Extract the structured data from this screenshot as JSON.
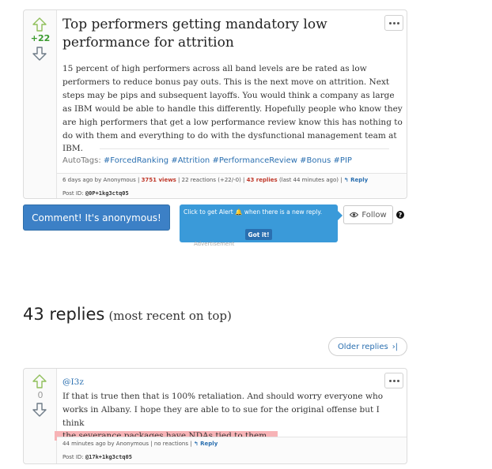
{
  "post": {
    "vote_score": "+22",
    "title": "Top performers getting mandatory low performance for attrition",
    "body": "15 percent of high performers across all band levels are be rated as low performers to reduce bonus pay outs. This is the next move on attrition. Next steps may be pips and subsequent layoffs. You would think a company as large as IBM would be able to handle this differently. Hopefully people who know they are high performers that get a low performance review know this has nothing to do with them and everything to do with the dysfunctional management team at IBM.",
    "autotags_label": "AutoTags:",
    "tags": [
      "#ForcedRanking",
      "#Attrition",
      "#PerformanceReview",
      "#Bonus",
      "#PIP"
    ],
    "meta": {
      "posted": "6 days ago by Anonymous",
      "views": "3751 views",
      "reactions": "22 reactions (+22/-0)",
      "replies": "43 replies",
      "last": "(last 44 minutes ago)",
      "reply_label": "Reply",
      "post_id_label": "Post ID:",
      "post_id": "@0P+1kg3ctq05"
    }
  },
  "actions": {
    "comment_label": "Comment! It's anonymous!",
    "alert_text_pre": "Click to get Alert",
    "alert_text_post": "when there is a new reply.",
    "got_it": "Got it!",
    "advertisement": "Advertisement",
    "follow_label": "Follow",
    "help": "?"
  },
  "replies_section": {
    "count_label": "43 replies",
    "order_label": "(most recent on top)",
    "older_label": "Older replies"
  },
  "reply": {
    "vote_score": "0",
    "user": "@I3z",
    "line1": "If that is true then that is 100% retaliation. And should worry everyone who",
    "line2": "works in Albany. I hope they are able to to sue for the original offense but I think",
    "line3": "the severance packages have NDAs tied to them.",
    "meta": {
      "posted": "44 minutes ago by Anonymous",
      "reactions": "no reactions",
      "reply_label": "Reply",
      "post_id_label": "Post ID:",
      "post_id": "@17k+1kg3ctq05"
    }
  },
  "colors": {
    "upvote": "#8fbf5a",
    "downvote": "#6d7a86",
    "positive_score": "#3a9a2e",
    "link": "#2a6fb0",
    "highlight": "#f7b3b6"
  },
  "icons": {
    "upvote": "thumb-up-icon",
    "downvote": "thumb-down-icon",
    "menu": "more-options-icon",
    "bell": "bell-icon",
    "eye": "eye-icon",
    "reply": "reply-arrow-icon",
    "older": "chevron-end-icon"
  }
}
